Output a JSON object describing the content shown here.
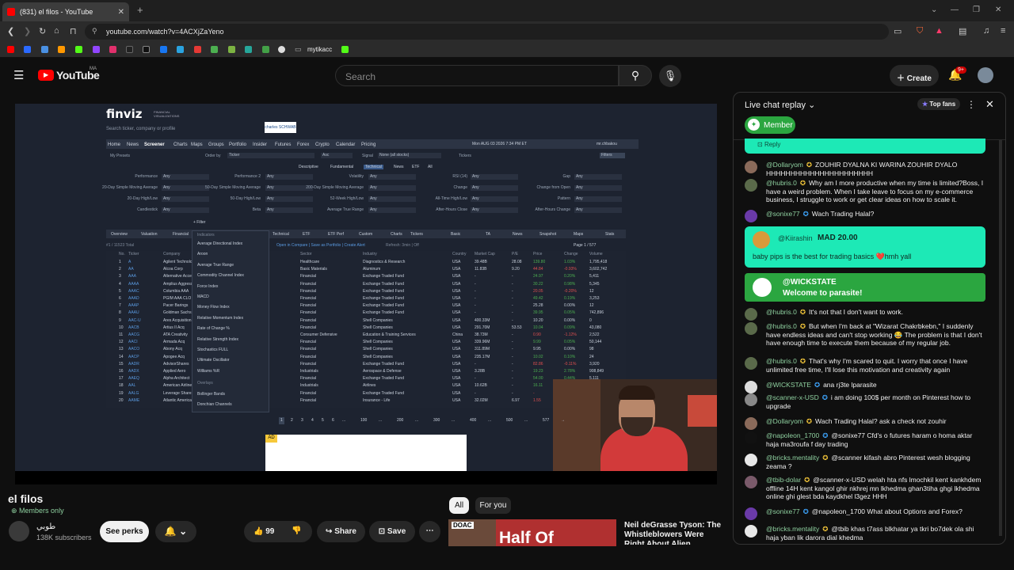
{
  "browser": {
    "tab_title": "(831) el filos - YouTube",
    "url": "youtube.com/watch?v=4ACXjZaYeno",
    "bookmark_folder": "mytikacc"
  },
  "youtube": {
    "logo_text": "YouTube",
    "logo_region": "MA",
    "search_placeholder": "Search",
    "create_label": "Create",
    "notif_count": "9+"
  },
  "finviz": {
    "logo": "finviz",
    "logo_sub": "FINANCIAL VISUALIZATIONS",
    "search_placeholder": "Search ticker, company or profile",
    "menu": [
      "Home",
      "News",
      "Screener",
      "Charts",
      "Maps",
      "Groups",
      "Portfolio",
      "Insider",
      "Futures",
      "Forex",
      "Crypto",
      "Calendar",
      "Pricing"
    ],
    "datetime": "Mon AUG 03 2026 7:34 PM ET",
    "user": "mr.chbakou",
    "my_presets": "My Presets",
    "order_by": "Order by",
    "ticker": "Ticker",
    "asc": "Asc",
    "signal": "Signal",
    "signal_val": "None (all stocks)",
    "tickers_lbl": "Tickers",
    "filters": "Filters",
    "filter_tabs": [
      "Descriptive",
      "Fundamental",
      "Technical",
      "News",
      "ETF",
      "All"
    ],
    "filters_rows": [
      [
        "Performance",
        "Any",
        "Performance 2",
        "Any",
        "Volatility",
        "Any",
        "RSI (14)",
        "Any",
        "Gap",
        "Any"
      ],
      [
        "20-Day Simple Moving Average",
        "Any",
        "50-Day Simple Moving Average",
        "Any",
        "200-Day Simple Moving Average",
        "Any",
        "Change",
        "Any",
        "Change from Open",
        "Any"
      ],
      [
        "20-Day High/Low",
        "Any",
        "50-Day High/Low",
        "Any",
        "52-Week High/Low",
        "Any",
        "All-Time High/Low",
        "Any",
        "Pattern",
        "Any"
      ],
      [
        "Candlestick",
        "Any",
        "Beta",
        "Any",
        "Average True Range",
        "Any",
        "After-Hours Close",
        "Any",
        "After-Hours Change",
        "Any"
      ]
    ],
    "add_filter": "+ Filter",
    "view_tabs": [
      "Overview",
      "Valuation",
      "Financial",
      "Ownership",
      "Performance",
      "Technical",
      "ETF",
      "ETF Perf",
      "Custom",
      "Charts",
      "Tickers",
      "Basic",
      "TA",
      "News",
      "Snapshot",
      "Maps",
      "Stats"
    ],
    "total": "#1 / 11523 Total",
    "open_compare": "Open in Compare | Save as Portfolio | Create Alert",
    "refresh": "Refresh: 3min | Off",
    "page": "Page 1 / 577",
    "columns": [
      "No.",
      "Ticker",
      "Company",
      "Sector",
      "Industry",
      "Country",
      "Market Cap",
      "P/E",
      "Price",
      "Change",
      "Volume"
    ],
    "rows": [
      [
        "1",
        "A",
        "Agilent Technologies",
        "Healthcare",
        "Diagnostics & Research",
        "USA",
        "39.48B",
        "28.08",
        "139.80",
        "1.03%",
        "1,795,418"
      ],
      [
        "2",
        "AA",
        "Alcoa Corp",
        "Basic Materials",
        "Aluminum",
        "USA",
        "11.83B",
        "9.20",
        "44.84",
        "-0.93%",
        "3,602,742"
      ],
      [
        "3",
        "AAA",
        "Alternative Access",
        "Financial",
        "Exchange Traded Fund",
        "USA",
        "-",
        "-",
        "24.97",
        "0.20%",
        "5,411"
      ],
      [
        "4",
        "AAAA",
        "Amplius Aggressive",
        "Financial",
        "Exchange Traded Fund",
        "USA",
        "-",
        "-",
        "30.22",
        "0.98%",
        "5,345"
      ],
      [
        "5",
        "AAAC",
        "Columbia AAA",
        "Financial",
        "Exchange Traded Fund",
        "USA",
        "-",
        "-",
        "20.05",
        "-0.20%",
        "12"
      ],
      [
        "6",
        "AAAD",
        "PGIM AAA CLO",
        "Financial",
        "Exchange Traded Fund",
        "USA",
        "-",
        "-",
        "49.42",
        "0.19%",
        "3,253"
      ],
      [
        "7",
        "AAAP",
        "Pacer Barings",
        "Financial",
        "Exchange Traded Fund",
        "USA",
        "-",
        "-",
        "25.28",
        "0.00%",
        "12"
      ],
      [
        "8",
        "AAAU",
        "Goldman Sachs",
        "Financial",
        "Exchange Traded Fund",
        "USA",
        "-",
        "-",
        "39.95",
        "0.05%",
        "742,896"
      ],
      [
        "9",
        "AAC-U",
        "Ares Acquisition",
        "Financial",
        "Shell Companies",
        "USA",
        "400.33M",
        "-",
        "10.20",
        "0.00%",
        "0"
      ],
      [
        "10",
        "AACB",
        "Artius II Acq",
        "Financial",
        "Shell Companies",
        "USA",
        "291.70M",
        "53.53",
        "10.04",
        "0.09%",
        "43,080"
      ],
      [
        "11",
        "AACG",
        "ATA Creativity",
        "Consumer Defensive",
        "Education & Training Services",
        "China",
        "38.73M",
        "-",
        "0.90",
        "-1.12%",
        "2,522"
      ],
      [
        "12",
        "AACI",
        "Armada Acq",
        "Financial",
        "Shell Companies",
        "USA",
        "339.96M",
        "-",
        "9.99",
        "0.05%",
        "50,144"
      ],
      [
        "13",
        "AACO",
        "Abony Acq",
        "Financial",
        "Shell Companies",
        "USA",
        "311.89M",
        "-",
        "9.95",
        "0.00%",
        "98"
      ],
      [
        "14",
        "AACP",
        "Apogee Acq",
        "Financial",
        "Shell Companies",
        "USA",
        "235.17M",
        "-",
        "10.02",
        "0.10%",
        "24"
      ],
      [
        "15",
        "AADR",
        "AdvisorShares",
        "Financial",
        "Exchange Traded Fund",
        "USA",
        "-",
        "-",
        "82.86",
        "-0.11%",
        "3,920"
      ],
      [
        "16",
        "AADX",
        "Applied Aero",
        "Industrials",
        "Aerospace & Defense",
        "USA",
        "3.28B",
        "-",
        "19.23",
        "2.78%",
        "908,849"
      ],
      [
        "17",
        "AAEQ",
        "Alpha Architect",
        "Financial",
        "Exchange Traded Fund",
        "USA",
        "-",
        "-",
        "54.00",
        "0.44%",
        "5,111"
      ],
      [
        "18",
        "AAL",
        "American Airlines",
        "Industrials",
        "Airlines",
        "USA",
        "10.62B",
        "-",
        "16.11",
        "1.01%",
        "-"
      ],
      [
        "19",
        "AALG",
        "Leverage Shares",
        "Financial",
        "Exchange Traded Fund",
        "USA",
        "-",
        "-",
        "-",
        "-",
        "-"
      ],
      [
        "20",
        "AAME",
        "Atlantic American",
        "Financial",
        "Insurance - Life",
        "USA",
        "32.02M",
        "6.97",
        "1.55",
        "-",
        "-"
      ]
    ],
    "dropdown_header": "Indicators",
    "dropdown_items": [
      "Average Directional Index",
      "Aroon",
      "Average True Range",
      "Commodity Channel Index",
      "Force Index",
      "MACD",
      "Money Flow Index",
      "Relative Momentum Index",
      "Rate of Change %",
      "Relative Strength Index",
      "Stochastics FULL",
      "Ultimate Oscillator",
      "Williams %R"
    ],
    "dropdown_header2": "Overlays",
    "dropdown_items2": [
      "Bollinger Bands",
      "Donchian Channels"
    ],
    "pagination": [
      "1",
      "2",
      "3",
      "4",
      "5",
      "6",
      "...",
      "100",
      "...",
      "200",
      "...",
      "300",
      "...",
      "400",
      "...",
      "500",
      "...",
      "577",
      "→"
    ],
    "ad_label": "AD",
    "broker_logo": "charles SCHWAB"
  },
  "video": {
    "title": "el filos",
    "members_only": "Members only",
    "channel_name": "طوبي",
    "subscribers": "138K subscribers",
    "see_perks": "See perks",
    "likes": "99",
    "share": "Share",
    "save": "Save"
  },
  "recommendations": {
    "chips": [
      "All",
      "For you"
    ],
    "item_title": "Neil deGrasse Tyson: The Whistleblowers Were Right About Alien",
    "thumb_text": "Half Of",
    "thumb_badge": "DOAC"
  },
  "chat": {
    "title": "Live chat replay",
    "top_fans": "Top fans",
    "member_btn": "Member",
    "reply": "Reply",
    "messages": [
      {
        "author": "@Dollaryom",
        "text": "ZOUHIR DYALNA KI WARINA ZOUHIR DYALO HHHHHHHHHHHHHHHHHHHHHH",
        "color": "#8a6a5a"
      },
      {
        "author": "@hubris.0",
        "text": "Why am I more productive when my time is limited?Boss, I have a weird problem. When I take leave to focus on my e-commerce business, I struggle to work or get clear ideas on how to scale it.",
        "color": "#5a6a4a"
      },
      {
        "author": "@sonixe77",
        "text": "Wach Trading Halal?",
        "color": "#6a3aa8"
      }
    ],
    "superchat": {
      "author": "@Kiirashin",
      "amount": "MAD 20.00",
      "text": "baby pips is the best for trading basics ❤️hmh yall"
    },
    "welcome": {
      "author": "@WICKSTATE",
      "text": "Welcome to parasite!"
    },
    "messages2": [
      {
        "author": "@hubris.0",
        "text": "It's not that I don't want to work.",
        "color": "#5a6a4a"
      },
      {
        "author": "@hubris.0",
        "text": "But when I'm back at \"Wizarat Chakrbkebn,\" I suddenly have endless ideas and can't stop working 😂 The problem is that I don't have enough time to execute them because of my regular job.",
        "color": "#5a6a4a"
      },
      {
        "author": "@hubris.0",
        "text": "That's why I'm scared to quit. I worry that once I have unlimited free time, I'll lose this motivation and creativity again",
        "color": "#5a6a4a"
      },
      {
        "author": "@WICKSTATE",
        "text": "ana rj3te lparasite",
        "color": "#dddddd"
      },
      {
        "author": "@scanner-x-USD",
        "text": "i am doing 100$ per month on Pinterest how to upgrade",
        "color": "#888888"
      },
      {
        "author": "@Dollaryom",
        "text": "Wach Trading Halal? ask a check not zouhir",
        "color": "#8a6a5a"
      },
      {
        "author": "@napoleon_1700",
        "text": "@sonixe77 Cfd's o futures haram o homa aktar haja ma3roufa f day trading",
        "color": "#111111"
      },
      {
        "author": "@bricks.mentality",
        "text": "@scanner kifash abro Pinterest wesh blogging zeama ?",
        "color": "#e8e8e8"
      },
      {
        "author": "@tbib-dolar",
        "text": "@scanner-x-USD welah hta nfs lmochkil kent kankhdem offline 14H kent kangol ghir nkhrej mn lkhedma ghan3tiha ghgi lkhedma online ghi glest bda kaydkhel l3gez HHH",
        "color": "#7a5a6a"
      },
      {
        "author": "@sonixe77",
        "text": "@napoleon_1700 What about Options and Forex?",
        "color": "#6a3aa8"
      },
      {
        "author": "@bricks.mentality",
        "text": "@tbib khas t7ass blkhatar ya tkri bo7dek ola shi haja yban lik darora dial khedma",
        "color": "#e8e8e8"
      }
    ]
  },
  "colors": {
    "yt_red": "#ff0000",
    "chat_green": "#2ba640",
    "superchat_cyan": "#1de9b6",
    "finviz_bg": "#1d2330"
  }
}
